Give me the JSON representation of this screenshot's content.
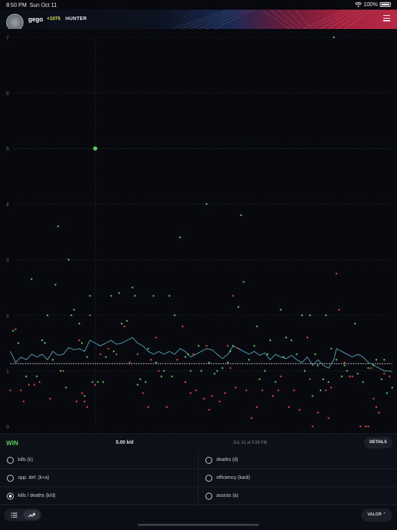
{
  "status_bar": {
    "time": "8:50 PM",
    "date": "Sun Oct 11",
    "battery": "100%"
  },
  "profile": {
    "username": "gego",
    "rr": "+1075",
    "rank": "HUNTER"
  },
  "chart_data": {
    "type": "scatter",
    "y_ticks": [
      "0",
      "1",
      "2",
      "3",
      "4",
      "5",
      "6",
      "7"
    ],
    "ylim": [
      0,
      7
    ],
    "grid": true,
    "reference_line": 1.13,
    "highlight": {
      "x": 32,
      "y": 5.0
    },
    "win_color": "#4fcf5b",
    "loss_color": "#e5483d",
    "trend_color": "#4fb2c8",
    "wins": [
      [
        1,
        1.72
      ],
      [
        3,
        1.5
      ],
      [
        6,
        0.9
      ],
      [
        8,
        2.65
      ],
      [
        10,
        0.9
      ],
      [
        12,
        1.55
      ],
      [
        13,
        1.5
      ],
      [
        14,
        2.0
      ],
      [
        16,
        1.2
      ],
      [
        17,
        2.55
      ],
      [
        18,
        3.6
      ],
      [
        19,
        1.0
      ],
      [
        21,
        0.7
      ],
      [
        22,
        3.0
      ],
      [
        23,
        2.0
      ],
      [
        24,
        2.1
      ],
      [
        26,
        1.85
      ],
      [
        27,
        1.5
      ],
      [
        28,
        0.55
      ],
      [
        29,
        1.25
      ],
      [
        30,
        2.35
      ],
      [
        31,
        0.8
      ],
      [
        33,
        0.8
      ],
      [
        35,
        0.8
      ],
      [
        36,
        1.25
      ],
      [
        38,
        2.35
      ],
      [
        39,
        1.35
      ],
      [
        41,
        2.4
      ],
      [
        42,
        1.85
      ],
      [
        44,
        1.9
      ],
      [
        46,
        2.5
      ],
      [
        47,
        2.35
      ],
      [
        48,
        0.75
      ],
      [
        49,
        0.85
      ],
      [
        51,
        0.8
      ],
      [
        52,
        1.4
      ],
      [
        54,
        2.35
      ],
      [
        55,
        1.15
      ],
      [
        57,
        0.9
      ],
      [
        58,
        1.0
      ],
      [
        60,
        2.35
      ],
      [
        61,
        0.9
      ],
      [
        62,
        2.0
      ],
      [
        64,
        3.4
      ],
      [
        66,
        1.25
      ],
      [
        67,
        1.3
      ],
      [
        68,
        1.0
      ],
      [
        71,
        1.45
      ],
      [
        72,
        1.0
      ],
      [
        74,
        4.0
      ],
      [
        75,
        1.15
      ],
      [
        77,
        0.95
      ],
      [
        78,
        1.0
      ],
      [
        80,
        1.05
      ],
      [
        82,
        1.15
      ],
      [
        83,
        1.35
      ],
      [
        84,
        1.45
      ],
      [
        86,
        2.15
      ],
      [
        87,
        3.8
      ],
      [
        88,
        2.6
      ],
      [
        90,
        1.2
      ],
      [
        92,
        1.45
      ],
      [
        93,
        1.8
      ],
      [
        94,
        0.85
      ],
      [
        96,
        1.0
      ],
      [
        97,
        1.3
      ],
      [
        98,
        1.55
      ],
      [
        100,
        0.8
      ],
      [
        102,
        2.1
      ],
      [
        103,
        1.25
      ],
      [
        104,
        1.6
      ],
      [
        106,
        1.55
      ],
      [
        108,
        1.3
      ],
      [
        110,
        2.0
      ],
      [
        111,
        1.0
      ],
      [
        113,
        2.0
      ],
      [
        114,
        0.55
      ],
      [
        115,
        1.3
      ],
      [
        116,
        1.1
      ],
      [
        117,
        0.65
      ],
      [
        118,
        0.85
      ],
      [
        119,
        2.0
      ],
      [
        120,
        0.8
      ],
      [
        121,
        1.4
      ],
      [
        122,
        7.0
      ],
      [
        123,
        1.2
      ],
      [
        125,
        0.9
      ],
      [
        126,
        1.1
      ],
      [
        127,
        1.0
      ],
      [
        130,
        1.85
      ],
      [
        131,
        0.95
      ],
      [
        133,
        0.8
      ],
      [
        135,
        1.05
      ],
      [
        137,
        1.1
      ],
      [
        138,
        1.2
      ],
      [
        140,
        0.85
      ],
      [
        141,
        1.2
      ],
      [
        142,
        0.6
      ],
      [
        144,
        0.7
      ]
    ],
    "losses": [
      [
        0,
        0.65
      ],
      [
        2,
        1.75
      ],
      [
        4,
        0.65
      ],
      [
        5,
        0.45
      ],
      [
        7,
        0.75
      ],
      [
        9,
        0.75
      ],
      [
        11,
        0.8
      ],
      [
        15,
        0.5
      ],
      [
        20,
        1.0
      ],
      [
        25,
        0.45
      ],
      [
        26,
        1.55
      ],
      [
        27,
        0.6
      ],
      [
        28,
        0.45
      ],
      [
        29,
        0.35
      ],
      [
        30,
        2.0
      ],
      [
        32,
        0.75
      ],
      [
        34,
        1.3
      ],
      [
        37,
        1.4
      ],
      [
        40,
        1.3
      ],
      [
        43,
        1.8
      ],
      [
        45,
        1.15
      ],
      [
        48,
        1.3
      ],
      [
        50,
        0.6
      ],
      [
        52,
        0.35
      ],
      [
        53,
        1.2
      ],
      [
        55,
        1.6
      ],
      [
        56,
        1.0
      ],
      [
        59,
        0.35
      ],
      [
        63,
        1.2
      ],
      [
        65,
        1.8
      ],
      [
        66,
        0.8
      ],
      [
        68,
        0.6
      ],
      [
        69,
        1.3
      ],
      [
        70,
        0.65
      ],
      [
        73,
        0.5
      ],
      [
        74,
        1.45
      ],
      [
        75,
        0.3
      ],
      [
        76,
        0.55
      ],
      [
        79,
        0.45
      ],
      [
        81,
        0.6
      ],
      [
        82,
        1.45
      ],
      [
        83,
        1.05
      ],
      [
        84,
        2.35
      ],
      [
        85,
        0.7
      ],
      [
        86,
        1.4
      ],
      [
        89,
        0.65
      ],
      [
        91,
        0.15
      ],
      [
        93,
        0.35
      ],
      [
        95,
        0.65
      ],
      [
        99,
        0.55
      ],
      [
        101,
        0.65
      ],
      [
        102,
        0.9
      ],
      [
        105,
        0.35
      ],
      [
        107,
        0.65
      ],
      [
        109,
        0.3
      ],
      [
        112,
        1.6
      ],
      [
        113,
        0.85
      ],
      [
        114,
        0.0
      ],
      [
        116,
        0.25
      ],
      [
        118,
        0.85
      ],
      [
        119,
        0.65
      ],
      [
        120,
        0.15
      ],
      [
        121,
        0.7
      ],
      [
        123,
        2.75
      ],
      [
        124,
        2.1
      ],
      [
        126,
        1.15
      ],
      [
        128,
        0.9
      ],
      [
        129,
        0.9
      ],
      [
        132,
        0.0
      ],
      [
        134,
        0.0
      ],
      [
        135,
        0.0
      ],
      [
        136,
        1.05
      ],
      [
        137,
        0.5
      ],
      [
        138,
        0.35
      ],
      [
        139,
        0.25
      ],
      [
        141,
        0.95
      ],
      [
        143,
        0.9
      ]
    ],
    "trend": [
      [
        0,
        1.35
      ],
      [
        2,
        1.15
      ],
      [
        4,
        1.25
      ],
      [
        6,
        1.2
      ],
      [
        8,
        1.3
      ],
      [
        10,
        1.25
      ],
      [
        12,
        1.3
      ],
      [
        14,
        1.2
      ],
      [
        16,
        1.35
      ],
      [
        18,
        1.28
      ],
      [
        20,
        1.3
      ],
      [
        22,
        1.42
      ],
      [
        24,
        1.38
      ],
      [
        26,
        1.4
      ],
      [
        28,
        1.35
      ],
      [
        30,
        1.55
      ],
      [
        32,
        1.5
      ],
      [
        34,
        1.45
      ],
      [
        36,
        1.5
      ],
      [
        38,
        1.55
      ],
      [
        40,
        1.48
      ],
      [
        42,
        1.5
      ],
      [
        44,
        1.55
      ],
      [
        46,
        1.6
      ],
      [
        48,
        1.5
      ],
      [
        50,
        1.45
      ],
      [
        52,
        1.35
      ],
      [
        54,
        1.3
      ],
      [
        56,
        1.35
      ],
      [
        58,
        1.3
      ],
      [
        60,
        1.35
      ],
      [
        62,
        1.3
      ],
      [
        64,
        1.4
      ],
      [
        66,
        1.35
      ],
      [
        68,
        1.25
      ],
      [
        70,
        1.3
      ],
      [
        72,
        1.35
      ],
      [
        74,
        1.4
      ],
      [
        76,
        1.38
      ],
      [
        78,
        1.3
      ],
      [
        80,
        1.22
      ],
      [
        82,
        1.3
      ],
      [
        84,
        1.45
      ],
      [
        86,
        1.4
      ],
      [
        88,
        1.35
      ],
      [
        90,
        1.3
      ],
      [
        92,
        1.35
      ],
      [
        94,
        1.28
      ],
      [
        96,
        1.32
      ],
      [
        98,
        1.2
      ],
      [
        100,
        1.3
      ],
      [
        102,
        1.25
      ],
      [
        104,
        1.22
      ],
      [
        106,
        1.28
      ],
      [
        108,
        1.2
      ],
      [
        110,
        1.15
      ],
      [
        112,
        1.25
      ],
      [
        114,
        1.1
      ],
      [
        116,
        1.2
      ],
      [
        118,
        1.1
      ],
      [
        120,
        1.05
      ],
      [
        122,
        1.2
      ],
      [
        123,
        1.4
      ],
      [
        125,
        1.35
      ],
      [
        127,
        1.3
      ],
      [
        129,
        1.25
      ],
      [
        131,
        1.3
      ],
      [
        133,
        1.25
      ],
      [
        135,
        1.15
      ],
      [
        137,
        1.1
      ],
      [
        139,
        1.05
      ],
      [
        141,
        1.0
      ],
      [
        143,
        1.0
      ],
      [
        144,
        0.98
      ]
    ]
  },
  "selected_match": {
    "result": "WIN",
    "kd": "5.00 k/d",
    "date": "JUL 31 at 5:59 PM",
    "details_label": "DETAILS"
  },
  "stat_options": [
    {
      "label": "kills (k)",
      "selected": false
    },
    {
      "label": "deaths (d)",
      "selected": false
    },
    {
      "label": "opp. def. (k+a)",
      "selected": false
    },
    {
      "label": "efficiency (ka/d)",
      "selected": false
    },
    {
      "label": "kills / deaths (k/d)",
      "selected": true
    },
    {
      "label": "assists (a)",
      "selected": false
    }
  ],
  "bottom_bar": {
    "game_label": "VALOR",
    "list_icon": "list-icon",
    "trend_icon": "trend-icon"
  }
}
